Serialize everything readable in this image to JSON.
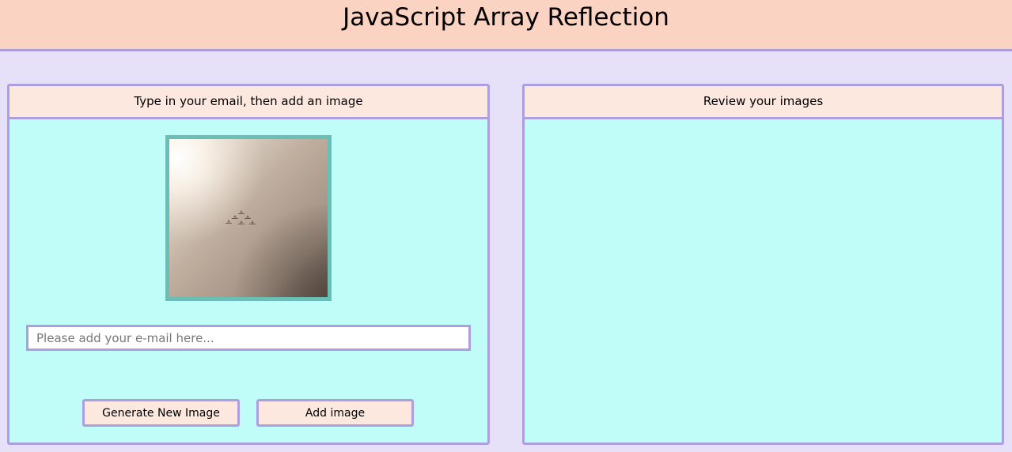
{
  "header": {
    "title": "JavaScript Array Reflection"
  },
  "left_panel": {
    "heading": "Type in your email, then add an image",
    "image": {
      "subject": "formation of jet planes in hazy sky"
    },
    "email": {
      "placeholder": "Please add your e-mail here...",
      "value": ""
    },
    "buttons": {
      "generate_label": "Generate New Image",
      "add_label": "Add image"
    }
  },
  "right_panel": {
    "heading": "Review your images",
    "images": []
  },
  "colors": {
    "page_background": "#e6e0f8",
    "header_background": "#fbd3c2",
    "border": "#ad9fdf",
    "panel_background": "#c0fcf8",
    "panel_heading_background": "#fde8e0",
    "image_border": "#69bfb6"
  }
}
